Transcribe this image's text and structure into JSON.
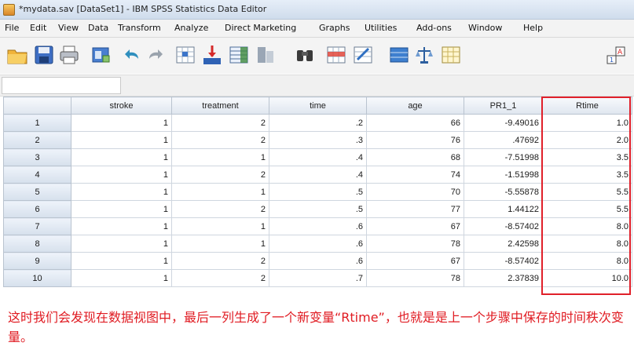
{
  "window": {
    "title": "*mydata.sav [DataSet1] - IBM SPSS Statistics Data Editor"
  },
  "menu": [
    "File",
    "Edit",
    "View",
    "Data",
    "Transform",
    "Analyze",
    "Direct Marketing",
    "Graphs",
    "Utilities",
    "Add-ons",
    "Window",
    "Help"
  ],
  "toolbar_icons": [
    "open-icon",
    "save-icon",
    "print-icon",
    "dialog-recall-icon",
    "undo-icon",
    "redo-icon",
    "goto-case-icon",
    "goto-variable-icon",
    "variables-icon",
    "run-descriptives-icon",
    "find-icon",
    "insert-cases-icon",
    "insert-variable-icon",
    "split-file-icon",
    "weight-cases-icon",
    "select-cases-icon",
    "value-labels-icon"
  ],
  "grid": {
    "columns": [
      "stroke",
      "treatment",
      "time",
      "age",
      "PR1_1",
      "Rtime"
    ],
    "rows": [
      [
        "1",
        "1",
        "2",
        ".2",
        "66",
        "-9.49016",
        "1.0"
      ],
      [
        "2",
        "1",
        "2",
        ".3",
        "76",
        ".47692",
        "2.0"
      ],
      [
        "3",
        "1",
        "1",
        ".4",
        "68",
        "-7.51998",
        "3.5"
      ],
      [
        "4",
        "1",
        "2",
        ".4",
        "74",
        "-1.51998",
        "3.5"
      ],
      [
        "5",
        "1",
        "1",
        ".5",
        "70",
        "-5.55878",
        "5.5"
      ],
      [
        "6",
        "1",
        "2",
        ".5",
        "77",
        "1.44122",
        "5.5"
      ],
      [
        "7",
        "1",
        "1",
        ".6",
        "67",
        "-8.57402",
        "8.0"
      ],
      [
        "8",
        "1",
        "1",
        ".6",
        "78",
        "2.42598",
        "8.0"
      ],
      [
        "9",
        "1",
        "2",
        ".6",
        "67",
        "-8.57402",
        "8.0"
      ],
      [
        "10",
        "1",
        "2",
        ".7",
        "78",
        "2.37839",
        "10.0"
      ]
    ]
  },
  "caption": "这时我们会发现在数据视图中，最后一列生成了一个新变量“Rtime”，也就是是上一个步骤中保存的时间秩次变量。",
  "colors": {
    "highlight": "#e0202a",
    "caption": "#e01b22"
  }
}
